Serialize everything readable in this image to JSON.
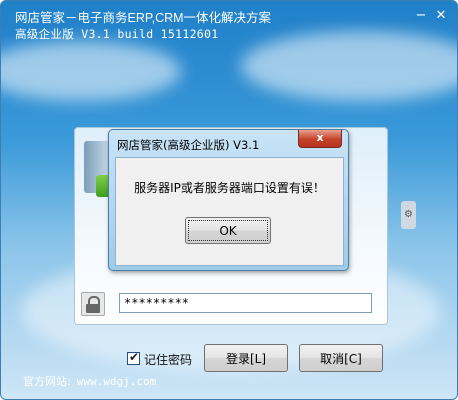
{
  "window": {
    "title_line1": "网店管家－电子商务ERP,CRM一体化解决方案",
    "title_line2": "高级企业版 V3.1 build 15112601",
    "minimize_glyph": "−",
    "close_glyph": "✕"
  },
  "login": {
    "password_masked": "*********",
    "remember_label": "记住密码",
    "remember_checked": true,
    "login_button": "登录[L]",
    "cancel_button": "取消[C]"
  },
  "footer": {
    "site_label": "官方网站:",
    "site_url": "www.wdgj.com"
  },
  "dialog": {
    "title": "网店管家(高级企业版) V3.1",
    "close_glyph": "x",
    "message": "服务器IP或者服务器端口设置有误！",
    "ok_button": "OK"
  },
  "icons": {
    "lock": "lock-icon",
    "server": "server-icon",
    "gear": "gear-icon"
  },
  "colors": {
    "sky_top": "#1f7fc8",
    "sky_bottom": "#cfe6f6",
    "dialog_close": "#c5412a"
  }
}
